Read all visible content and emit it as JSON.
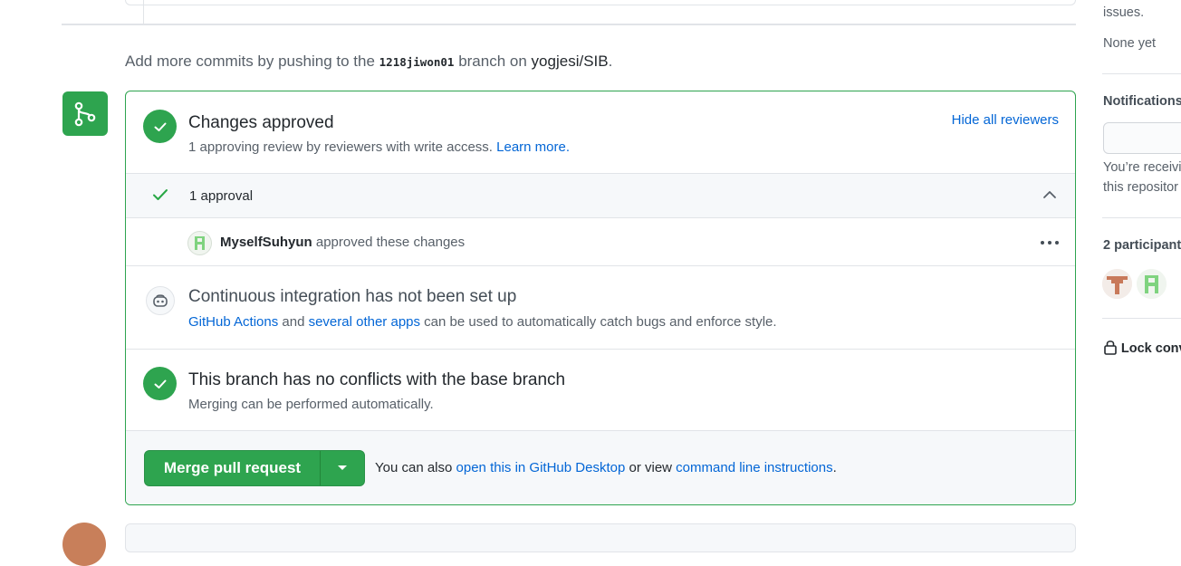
{
  "push_note": {
    "prefix": "Add more commits by pushing to the",
    "branch": "1218jiwon01",
    "middle": "branch on",
    "repo": "yogjesi/SIB",
    "suffix": "."
  },
  "merge_box": {
    "approved": {
      "title": "Changes approved",
      "description": "1 approving review by reviewers with write access.",
      "learn_more": "Learn more.",
      "hide_reviewers": "Hide all reviewers"
    },
    "approvals": {
      "label": "1 approval",
      "reviewer": "MyselfSuhyun",
      "action": "approved these changes"
    },
    "ci": {
      "title": "Continuous integration has not been set up",
      "link1": "GitHub Actions",
      "and": "and",
      "link2": "several other apps",
      "rest": "can be used to automatically catch bugs and enforce style."
    },
    "conflicts": {
      "title": "This branch has no conflicts with the base branch",
      "description": "Merging can be performed automatically."
    },
    "footer": {
      "merge_button": "Merge pull request",
      "hint_prefix": "You can also",
      "desktop_link": "open this in GitHub Desktop",
      "hint_middle": "or view",
      "cli_link": "command line instructions",
      "hint_suffix": "."
    }
  },
  "sidebar": {
    "issues_text": "issues.",
    "none_yet": "None yet",
    "notifications_heading": "Notifications",
    "notifications_desc_line1": "You’re receivi",
    "notifications_desc_line2": "this repositor",
    "participants_heading": "2 participant",
    "lock_label": "Lock conv"
  },
  "colors": {
    "success_green": "#2ea44f",
    "link_blue": "#0366d6",
    "border": "#e1e4e8"
  }
}
